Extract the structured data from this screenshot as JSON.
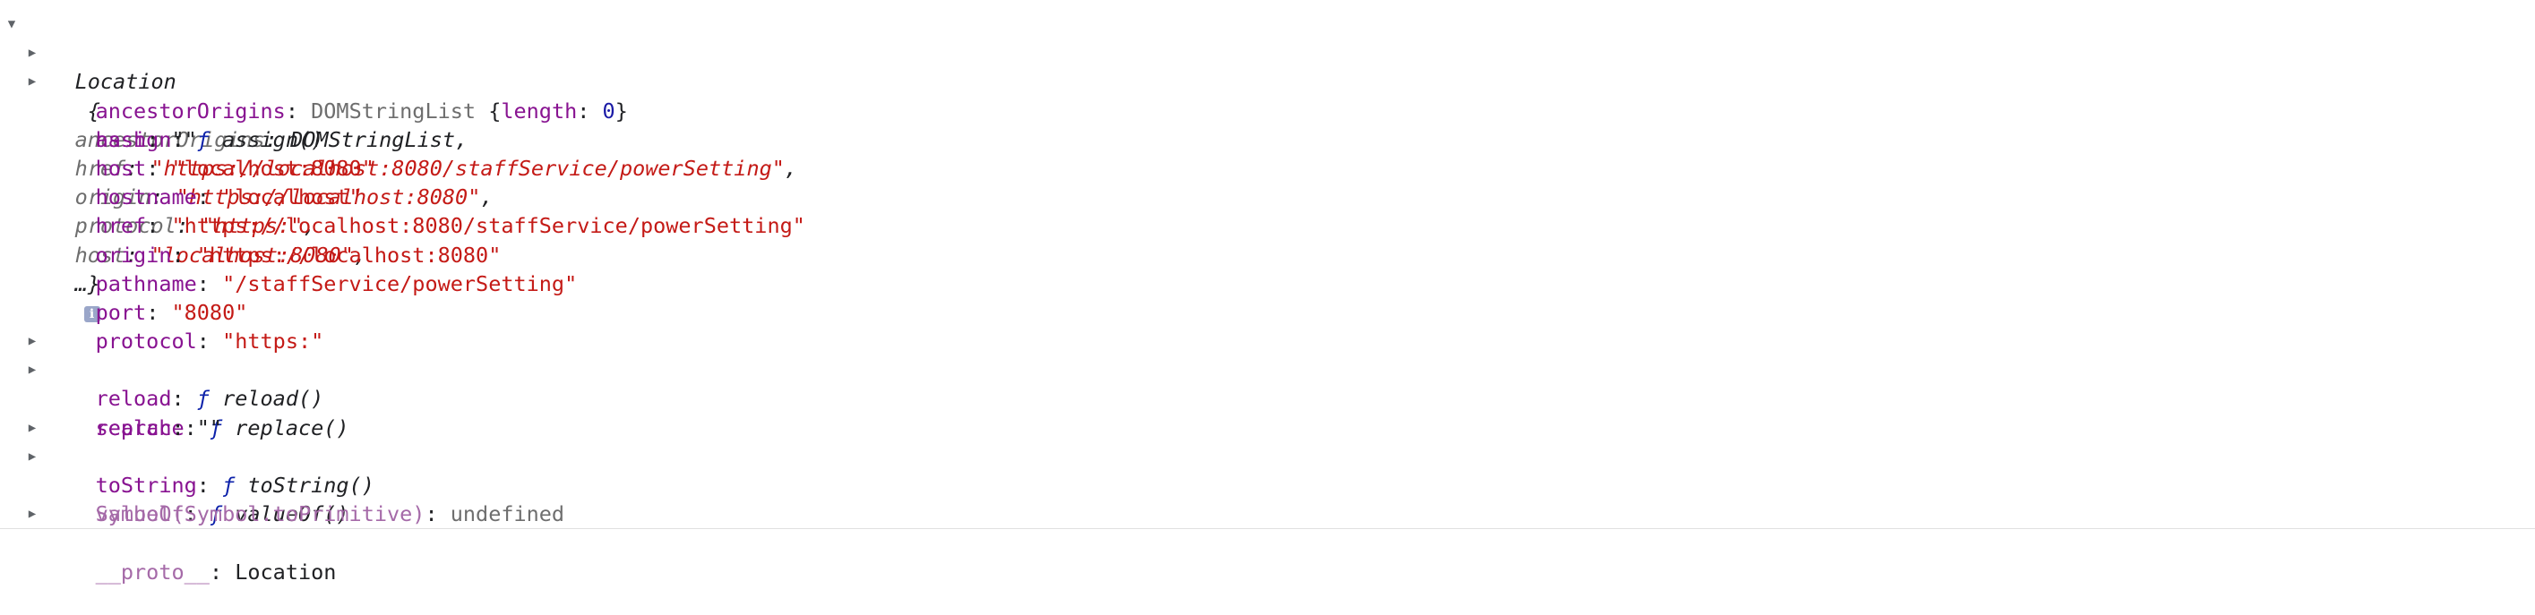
{
  "header": {
    "class_name": "Location",
    "preview": [
      {
        "key": "ancestorOrigins",
        "value": "DOMStringList",
        "type": "obj"
      },
      {
        "key": "href",
        "value": "\"https://localhost:8080/staffService/powerSetting\"",
        "type": "str"
      },
      {
        "key": "origin",
        "value": "\"https://localhost:8080\"",
        "type": "str"
      },
      {
        "key": "protocol",
        "value": "\"https:\"",
        "type": "str"
      },
      {
        "key": "host",
        "value": "\"localhost:8080\"",
        "type": "str"
      }
    ],
    "ellipsis": "…}",
    "info_glyph": "i"
  },
  "props": {
    "ancestorOrigins": {
      "key": "ancestorOrigins",
      "class": "DOMStringList",
      "len_key": "length",
      "len_val": "0"
    },
    "assign": {
      "key": "assign",
      "f": "ƒ",
      "sig": "assign()"
    },
    "hash": {
      "key": "hash",
      "value": "\"\""
    },
    "host": {
      "key": "host",
      "value": "\"localhost:8080\""
    },
    "hostname": {
      "key": "hostname",
      "value": "\"localhost\""
    },
    "href": {
      "key": "href",
      "value": "\"https://localhost:8080/staffService/powerSetting\""
    },
    "origin": {
      "key": "origin",
      "value": "\"https://localhost:8080\""
    },
    "pathname": {
      "key": "pathname",
      "value": "\"/staffService/powerSetting\""
    },
    "port": {
      "key": "port",
      "value": "\"8080\""
    },
    "protocol": {
      "key": "protocol",
      "value": "\"https:\""
    },
    "reload": {
      "key": "reload",
      "f": "ƒ",
      "sig": "reload()"
    },
    "replace": {
      "key": "replace",
      "f": "ƒ",
      "sig": "replace()"
    },
    "search": {
      "key": "search",
      "value": "\"\""
    },
    "toString": {
      "key": "toString",
      "f": "ƒ",
      "sig": "toString()"
    },
    "valueOf": {
      "key": "valueOf",
      "f": "ƒ",
      "sig": "valueOf()"
    },
    "symbol": {
      "key": "Symbol(Symbol.toPrimitive)",
      "value": "undefined"
    },
    "proto": {
      "key": "__proto__",
      "value": "Location"
    }
  },
  "glyphs": {
    "expanded": "▼",
    "collapsed": "▶"
  }
}
